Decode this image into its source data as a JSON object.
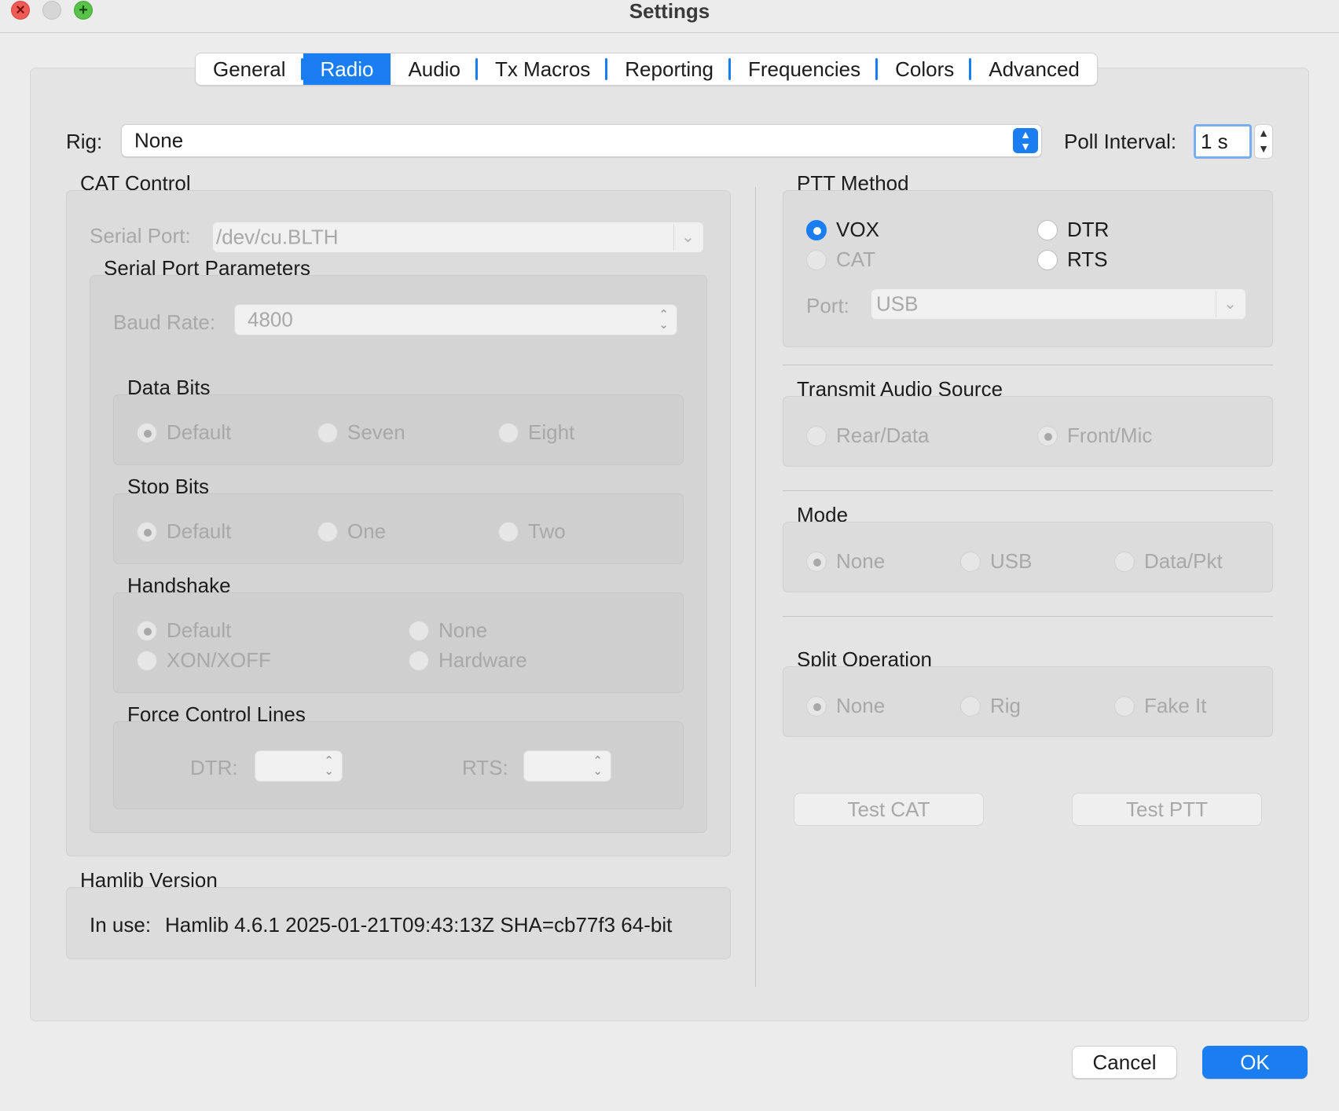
{
  "window": {
    "title": "Settings",
    "close_glyph": "×",
    "max_glyph": "+"
  },
  "tabs": [
    {
      "label": "General"
    },
    {
      "label": "Radio"
    },
    {
      "label": "Audio"
    },
    {
      "label": "Tx Macros"
    },
    {
      "label": "Reporting"
    },
    {
      "label": "Frequencies"
    },
    {
      "label": "Colors"
    },
    {
      "label": "Advanced"
    }
  ],
  "active_tab": "Radio",
  "rig": {
    "label": "Rig:",
    "value": "None",
    "poll_label": "Poll Interval:",
    "poll_value": "1 s"
  },
  "cat": {
    "title": "CAT Control",
    "serial_port_label": "Serial Port:",
    "serial_port_value": "/dev/cu.BLTH",
    "params_title": "Serial Port Parameters",
    "baud_label": "Baud Rate:",
    "baud_value": "4800",
    "data_bits": {
      "title": "Data Bits",
      "options": [
        "Default",
        "Seven",
        "Eight"
      ],
      "selected": "Default"
    },
    "stop_bits": {
      "title": "Stop Bits",
      "options": [
        "Default",
        "One",
        "Two"
      ],
      "selected": "Default"
    },
    "handshake": {
      "title": "Handshake",
      "options": [
        "Default",
        "None",
        "XON/XOFF",
        "Hardware"
      ],
      "selected": "Default"
    },
    "force": {
      "title": "Force Control Lines",
      "dtr_label": "DTR:",
      "rts_label": "RTS:"
    }
  },
  "hamlib": {
    "title": "Hamlib Version",
    "in_use_label": "In use:",
    "version": "Hamlib 4.6.1 2025-01-21T09:43:13Z SHA=cb77f3 64-bit"
  },
  "ptt": {
    "title": "PTT Method",
    "options": [
      "VOX",
      "DTR",
      "CAT",
      "RTS"
    ],
    "selected": "VOX",
    "port_label": "Port:",
    "port_value": "USB"
  },
  "tx_audio": {
    "title": "Transmit Audio Source",
    "options": [
      "Rear/Data",
      "Front/Mic"
    ],
    "selected": "Front/Mic"
  },
  "mode": {
    "title": "Mode",
    "options": [
      "None",
      "USB",
      "Data/Pkt"
    ],
    "selected": "None"
  },
  "split": {
    "title": "Split Operation",
    "options": [
      "None",
      "Rig",
      "Fake It"
    ],
    "selected": "None"
  },
  "buttons": {
    "test_cat": "Test CAT",
    "test_ptt": "Test PTT",
    "cancel": "Cancel",
    "ok": "OK"
  },
  "colors": {
    "accent": "#1a7ef2",
    "close": "#ee5c55",
    "minimize": "#d6d6d6",
    "maximize": "#5ac24a"
  },
  "icons": {
    "close": "close-icon",
    "minimize": "minimize-icon",
    "maximize": "maximize-icon",
    "select": "chevron-updown-icon",
    "combo": "chevron-down-icon"
  }
}
